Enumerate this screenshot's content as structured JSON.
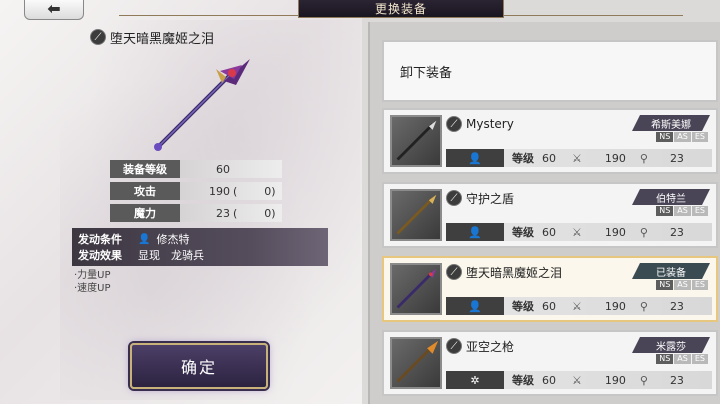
{
  "header": {
    "back_glyph": "⬅",
    "title": "更换装备"
  },
  "detail": {
    "name": "堕天暗黑魔姬之泪",
    "stats": [
      {
        "label": "装备等级",
        "value": "60",
        "bonus": ""
      },
      {
        "label": "攻击",
        "value": "190",
        "bonus": "0"
      },
      {
        "label": "魔力",
        "value": "23",
        "bonus": "0"
      }
    ],
    "skill": {
      "condition_label": "发动条件",
      "condition_value": "修杰特",
      "effect_label": "发动效果",
      "effect_value": "显现　龙骑兵"
    },
    "effects": [
      "·力量UP",
      "·速度UP"
    ],
    "confirm_label": "确定"
  },
  "list": {
    "unequip_label": "卸下装备",
    "level_label": "等级",
    "items": [
      {
        "name": "Mystery",
        "owner": "希斯美娜",
        "tags": [
          "NS",
          "AS",
          "ES"
        ],
        "level": "60",
        "atk": "190",
        "mag": "23",
        "equipped": false,
        "icon": "person-icon"
      },
      {
        "name": "守护之盾",
        "owner": "伯特兰",
        "tags": [
          "NS",
          "AS",
          "ES"
        ],
        "level": "60",
        "atk": "190",
        "mag": "23",
        "equipped": false,
        "icon": "person-icon"
      },
      {
        "name": "堕天暗黑魔姬之泪",
        "owner": "已装备",
        "tags": [
          "NS",
          "AS",
          "ES"
        ],
        "level": "60",
        "atk": "190",
        "mag": "23",
        "equipped": true,
        "icon": "person-icon"
      },
      {
        "name": "亚空之枪",
        "owner": "米露莎",
        "tags": [
          "NS",
          "AS",
          "ES"
        ],
        "level": "60",
        "atk": "190",
        "mag": "23",
        "equipped": false,
        "icon": "snowflake-icon"
      }
    ]
  }
}
